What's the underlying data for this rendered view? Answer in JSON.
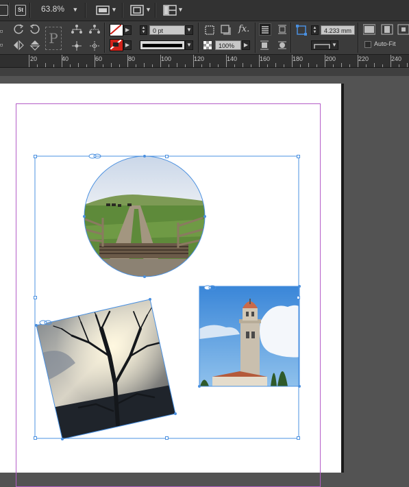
{
  "app_bar": {
    "bridge_badge": "St",
    "zoom": "63.8%",
    "zoom_caret": "▼",
    "view_caret": "▼",
    "screen_caret": "▼",
    "arrange_caret": "▼"
  },
  "control_panel": {
    "reference_letter": "P",
    "stroke_weight": "0 pt",
    "opacity": "100%",
    "offset_value": "4.233 mm",
    "fx_label": "fx.",
    "auto_fit_label": "Auto-Fit"
  },
  "ruler": {
    "labels": [
      "20",
      "40",
      "60",
      "80",
      "100",
      "120",
      "140",
      "160",
      "180",
      "200",
      "220",
      "240"
    ]
  },
  "document": {
    "images": [
      {
        "name": "country-lane-cattle-grid",
        "shape": "circle"
      },
      {
        "name": "bare-tree-silhouette",
        "shape": "rotated-square"
      },
      {
        "name": "church-bell-tower",
        "shape": "square"
      }
    ]
  },
  "colors": {
    "selection": "#4a90e0",
    "margin_guide": "#b45cc7",
    "ui_dark": "#323232",
    "stroke_none_red": "#d0221a"
  }
}
